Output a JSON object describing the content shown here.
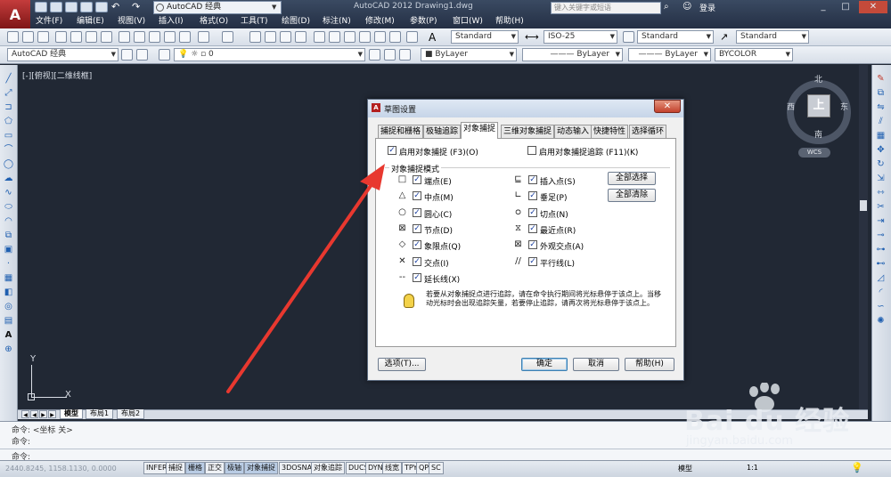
{
  "app": {
    "title": "AutoCAD 2012    Drawing1.dwg",
    "workspace": "AutoCAD 经典",
    "search_placeholder": "键入关键字或短语",
    "login": "登录",
    "menus": [
      "文件(F)",
      "编辑(E)",
      "视图(V)",
      "插入(I)",
      "格式(O)",
      "工具(T)",
      "绘图(D)",
      "标注(N)",
      "修改(M)",
      "参数(P)",
      "窗口(W)",
      "帮助(H)"
    ]
  },
  "toolbar2": {
    "workspace": "AutoCAD 经典",
    "layer": "0",
    "color": "ByLayer",
    "linetype": "ByLayer",
    "lineweight": "ByLayer",
    "plotstyle": "BYCOLOR"
  },
  "toolbar1": {
    "text_style": "Standard",
    "dim_style": "ISO-25",
    "table_style": "Standard",
    "mleader_style": "Standard"
  },
  "viewport": {
    "label": "[-][俯视][二维线框]"
  },
  "viewcube": {
    "north": "北",
    "south": "南",
    "east": "东",
    "west": "西",
    "face": "上",
    "wcs": "WCS"
  },
  "ucs": {
    "y": "Y",
    "x": "X"
  },
  "layout_tabs": [
    "模型",
    "布局1",
    "布局2"
  ],
  "command": {
    "line1": "命令:  <坐标 关>",
    "line2": "命令:",
    "line3": "命令:"
  },
  "status": {
    "coords": "2440.8245, 1158.1130, 0.0000",
    "buttons": [
      "INFER",
      "捕捉",
      "栅格",
      "正交",
      "极轴",
      "对象捕捉",
      "3DOSNAP",
      "对象追踪",
      "DUCS",
      "DYN",
      "线宽",
      "TPY",
      "QP",
      "SC"
    ],
    "on": [
      "栅格",
      "极轴",
      "对象捕捉"
    ],
    "model": "模型",
    "scale": "1:1"
  },
  "dialog": {
    "title": "草图设置",
    "close": "✕",
    "tabs": [
      "捕捉和栅格",
      "极轴追踪",
      "对象捕捉",
      "三维对象捕捉",
      "动态输入",
      "快捷特性",
      "选择循环"
    ],
    "selected_tab": "对象捕捉",
    "enable_osnap": "启用对象捕捉 (F3)(O)",
    "enable_tracking": "启用对象捕捉追踪 (F11)(K)",
    "group_label": "对象捕捉模式",
    "left_modes": [
      {
        "sym": "□",
        "label": "端点(E)",
        "checked": true
      },
      {
        "sym": "△",
        "label": "中点(M)",
        "checked": true
      },
      {
        "sym": "○",
        "label": "圆心(C)",
        "checked": true
      },
      {
        "sym": "⊠",
        "label": "节点(D)",
        "checked": true
      },
      {
        "sym": "◇",
        "label": "象限点(Q)",
        "checked": true
      },
      {
        "sym": "✕",
        "label": "交点(I)",
        "checked": true
      },
      {
        "sym": "--",
        "label": "延长线(X)",
        "checked": true
      }
    ],
    "right_modes": [
      {
        "sym": "⊑",
        "label": "插入点(S)",
        "checked": true
      },
      {
        "sym": "∟",
        "label": "垂足(P)",
        "checked": true
      },
      {
        "sym": "ᴑ",
        "label": "切点(N)",
        "checked": true
      },
      {
        "sym": "⧖",
        "label": "最近点(R)",
        "checked": true
      },
      {
        "sym": "⊠",
        "label": "外观交点(A)",
        "checked": true
      },
      {
        "sym": "//",
        "label": "平行线(L)",
        "checked": true
      }
    ],
    "select_all": "全部选择",
    "clear_all": "全部清除",
    "note": "若要从对象捕捉点进行追踪，请在命令执行期间将光标悬停于该点上。当移动光标时会出现追踪矢量，若要停止追踪，请再次将光标悬停于该点上。",
    "options": "选项(T)...",
    "ok": "确定",
    "cancel": "取消",
    "help": "帮助(H)"
  },
  "watermark": {
    "brand": "Bai du 经验",
    "url": "jingyan.baidu.com"
  },
  "colors": {
    "drawing_bg": "#212834",
    "arrow": "#e8382f"
  }
}
